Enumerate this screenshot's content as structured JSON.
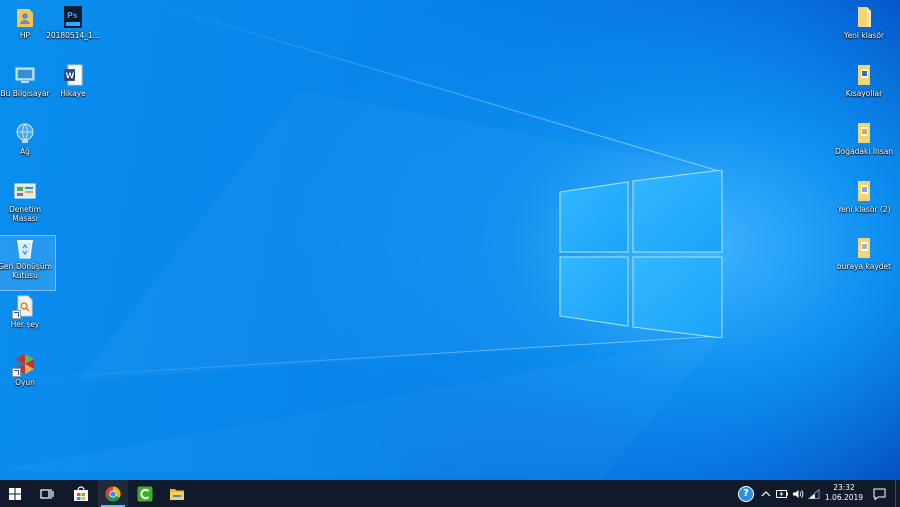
{
  "desktop": {
    "left_icons": [
      {
        "id": "hp",
        "label": "HP",
        "icon": "user-folder-icon"
      },
      {
        "id": "psd-file",
        "label": "20180514_1...",
        "icon": "photoshop-file-icon"
      },
      {
        "id": "bu-bilgisayar",
        "label": "Bu Bilgisayar",
        "icon": "this-pc-icon"
      },
      {
        "id": "hikaye",
        "label": "Hikaye",
        "icon": "word-document-icon"
      },
      {
        "id": "ag",
        "label": "Ağ",
        "icon": "network-icon"
      },
      {
        "id": "denetim-masasi",
        "label": "Denetim Masası",
        "icon": "control-panel-icon"
      },
      {
        "id": "geri-donusum",
        "label": "Geri Dönüşüm Kutusu",
        "icon": "recycle-bin-icon"
      },
      {
        "id": "her-sey",
        "label": "Her şey",
        "icon": "everything-search-icon"
      },
      {
        "id": "oyun",
        "label": "Oyun",
        "icon": "game-icon"
      }
    ],
    "right_icons": [
      {
        "id": "yeni-klasor",
        "label": "Yeni klasör",
        "icon": "folder-icon"
      },
      {
        "id": "kisayollar",
        "label": "Kısayollar",
        "icon": "folder-document-icon"
      },
      {
        "id": "dogadaki-insan",
        "label": "Doğadaki İnsan",
        "icon": "folder-document-icon"
      },
      {
        "id": "yeni-klasor-2",
        "label": "Yeni klasör (2)",
        "icon": "folder-document-icon"
      },
      {
        "id": "buraya-kaydet",
        "label": "buraya kaydet",
        "icon": "folder-document-icon"
      }
    ]
  },
  "taskbar": {
    "apps": [
      "start-icon",
      "task-view-icon",
      "store-icon",
      "chrome-icon",
      "camtasia-icon",
      "file-explorer-icon"
    ],
    "tray": {
      "help": "?",
      "time": "23:32",
      "date": "1.06.2019"
    }
  },
  "colors": {
    "taskbar": "#101a2b",
    "accent": "#0a8fee"
  }
}
